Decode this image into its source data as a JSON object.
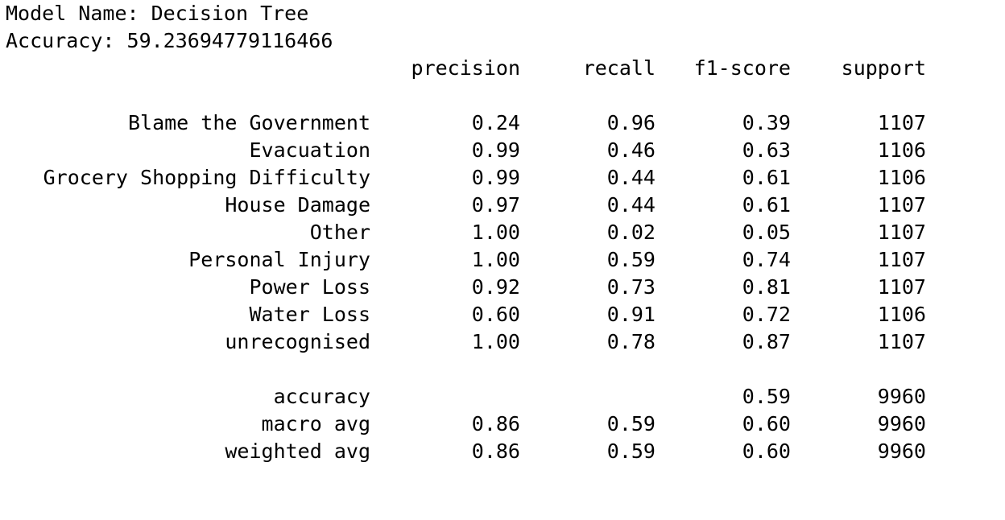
{
  "model_name_line": "Model Name: Decision Tree",
  "accuracy_line": "Accuracy: 59.23694779116466",
  "report": {
    "headers": {
      "precision": "precision",
      "recall": "recall",
      "f1": "f1-score",
      "support": "support"
    },
    "classes": [
      {
        "label": "Blame the Government",
        "precision": "0.24",
        "recall": "0.96",
        "f1": "0.39",
        "support": "1107"
      },
      {
        "label": "Evacuation",
        "precision": "0.99",
        "recall": "0.46",
        "f1": "0.63",
        "support": "1106"
      },
      {
        "label": "Grocery Shopping Difficulty",
        "precision": "0.99",
        "recall": "0.44",
        "f1": "0.61",
        "support": "1106"
      },
      {
        "label": "House Damage",
        "precision": "0.97",
        "recall": "0.44",
        "f1": "0.61",
        "support": "1107"
      },
      {
        "label": "Other",
        "precision": "1.00",
        "recall": "0.02",
        "f1": "0.05",
        "support": "1107"
      },
      {
        "label": "Personal Injury",
        "precision": "1.00",
        "recall": "0.59",
        "f1": "0.74",
        "support": "1107"
      },
      {
        "label": "Power Loss",
        "precision": "0.92",
        "recall": "0.73",
        "f1": "0.81",
        "support": "1107"
      },
      {
        "label": "Water Loss",
        "precision": "0.60",
        "recall": "0.91",
        "f1": "0.72",
        "support": "1106"
      },
      {
        "label": "unrecognised",
        "precision": "1.00",
        "recall": "0.78",
        "f1": "0.87",
        "support": "1107"
      }
    ],
    "summary": [
      {
        "label": "accuracy",
        "precision": "",
        "recall": "",
        "f1": "0.59",
        "support": "9960"
      },
      {
        "label": "macro avg",
        "precision": "0.86",
        "recall": "0.59",
        "f1": "0.60",
        "support": "9960"
      },
      {
        "label": "weighted avg",
        "precision": "0.86",
        "recall": "0.59",
        "f1": "0.60",
        "support": "9960"
      }
    ]
  }
}
